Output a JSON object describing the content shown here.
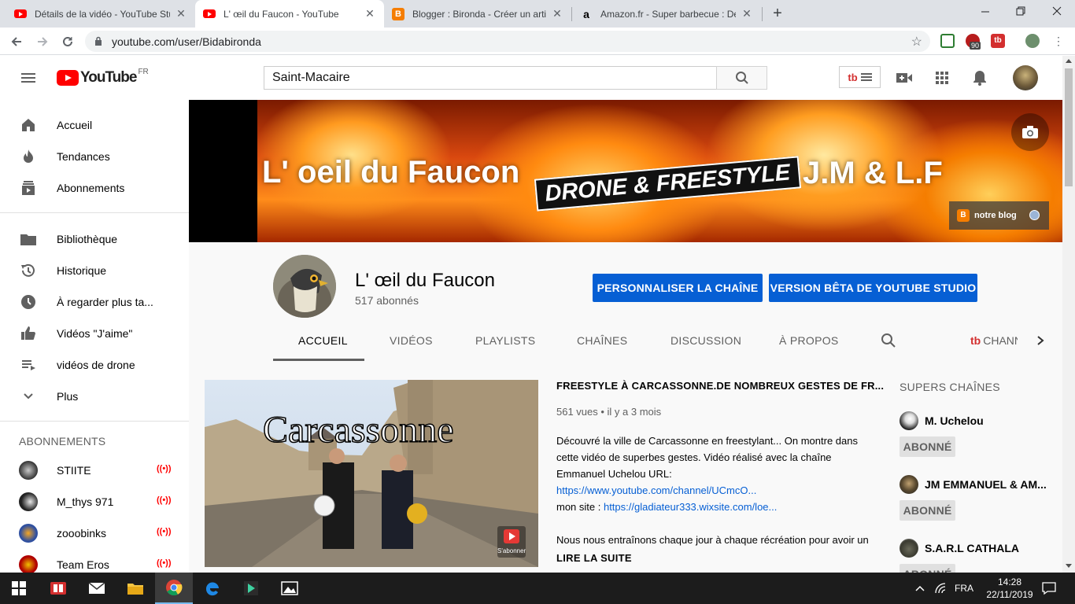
{
  "browser": {
    "tabs": [
      {
        "title": "Détails de la vidéo - YouTube Studio",
        "icon": "youtube-icon"
      },
      {
        "title": "L' œil du Faucon - YouTube",
        "icon": "youtube-icon",
        "active": true
      },
      {
        "title": "Blogger : Bironda - Créer un article",
        "icon": "blogger-icon"
      },
      {
        "title": "Amazon.fr - Super barbecue : Des",
        "icon": "amazon-icon"
      }
    ],
    "new_tab": "+",
    "url": "youtube.com/user/Bidabironda",
    "ext_badge": "90"
  },
  "masthead": {
    "logo_text": "YouTube",
    "logo_region": "FR",
    "search_value": "Saint-Macaire"
  },
  "sidebar": {
    "main": [
      {
        "label": "Accueil",
        "icon": "home-icon"
      },
      {
        "label": "Tendances",
        "icon": "trending-icon"
      },
      {
        "label": "Abonnements",
        "icon": "subscriptions-icon"
      }
    ],
    "library": [
      {
        "label": "Bibliothèque",
        "icon": "library-icon"
      },
      {
        "label": "Historique",
        "icon": "history-icon"
      },
      {
        "label": "À regarder plus ta...",
        "icon": "watch-later-icon"
      },
      {
        "label": "Vidéos \"J'aime\"",
        "icon": "like-icon"
      },
      {
        "label": "vidéos de drone",
        "icon": "playlist-icon"
      },
      {
        "label": "Plus",
        "icon": "chevron-down-icon"
      }
    ],
    "subs_heading": "ABONNEMENTS",
    "subs": [
      {
        "label": "STIITE",
        "live": "((•))"
      },
      {
        "label": "M_thys 971",
        "live": "((•))"
      },
      {
        "label": "zooobinks",
        "live": "((•))"
      },
      {
        "label": "Team Eros",
        "live": "((•))"
      }
    ]
  },
  "banner": {
    "title_left": "L' oeil du Faucon",
    "title_middle": "DRONE & FREESTYLE",
    "title_right": "J.M & L.F",
    "blog_link": "notre blog"
  },
  "channel": {
    "name": "L' œil du Faucon",
    "subscribers": "517 abonnés",
    "customize_btn": "PERSONNALISER LA CHAÎNE",
    "studio_btn": "VERSION BÊTA DE YOUTUBE STUDIO",
    "tabs": [
      "ACCUEIL",
      "VIDÉOS",
      "PLAYLISTS",
      "CHAÎNES",
      "DISCUSSION",
      "À PROPOS"
    ],
    "extra_tab": "CHANN"
  },
  "featured": {
    "thumb_text": "Carcassonne",
    "thumb_subscribe": "S'abonner",
    "title": "FREESTYLE À CARCASSONNE.DE NOMBREUX GESTES DE FR...",
    "views": "561 vues",
    "age": "il y a 3 mois",
    "desc_lines": [
      "Découvré la ville de Carcassonne en freestylant... On montre dans",
      "cette vidéo de superbes gestes. Vidéo réalisé avec la chaîne",
      "Emmanuel Uchelou URL:"
    ],
    "link1": "https://www.youtube.com/channel/UCmcO...",
    "site_label": "mon site : ",
    "link2": "https://gladiateur333.wixsite.com/loe...",
    "desc_last": "Nous nous entraînons chaque jour à chaque récréation pour avoir un",
    "read_more": "LIRE LA SUITE"
  },
  "super_channels": {
    "heading": "SUPERS CHAÎNES",
    "items": [
      {
        "name": "M. Uchelou",
        "button": "ABONNÉ"
      },
      {
        "name": "JM EMMANUEL & AM...",
        "button": "ABONNÉ"
      },
      {
        "name": "S.A.R.L CATHALA",
        "button": "ABONNÉ"
      }
    ]
  },
  "taskbar": {
    "lang": "FRA",
    "time": "14:28",
    "date": "22/11/2019"
  },
  "colors": {
    "youtube_red": "#ff0000",
    "link_blue": "#065fd4",
    "primary_button": "#065fd4"
  }
}
